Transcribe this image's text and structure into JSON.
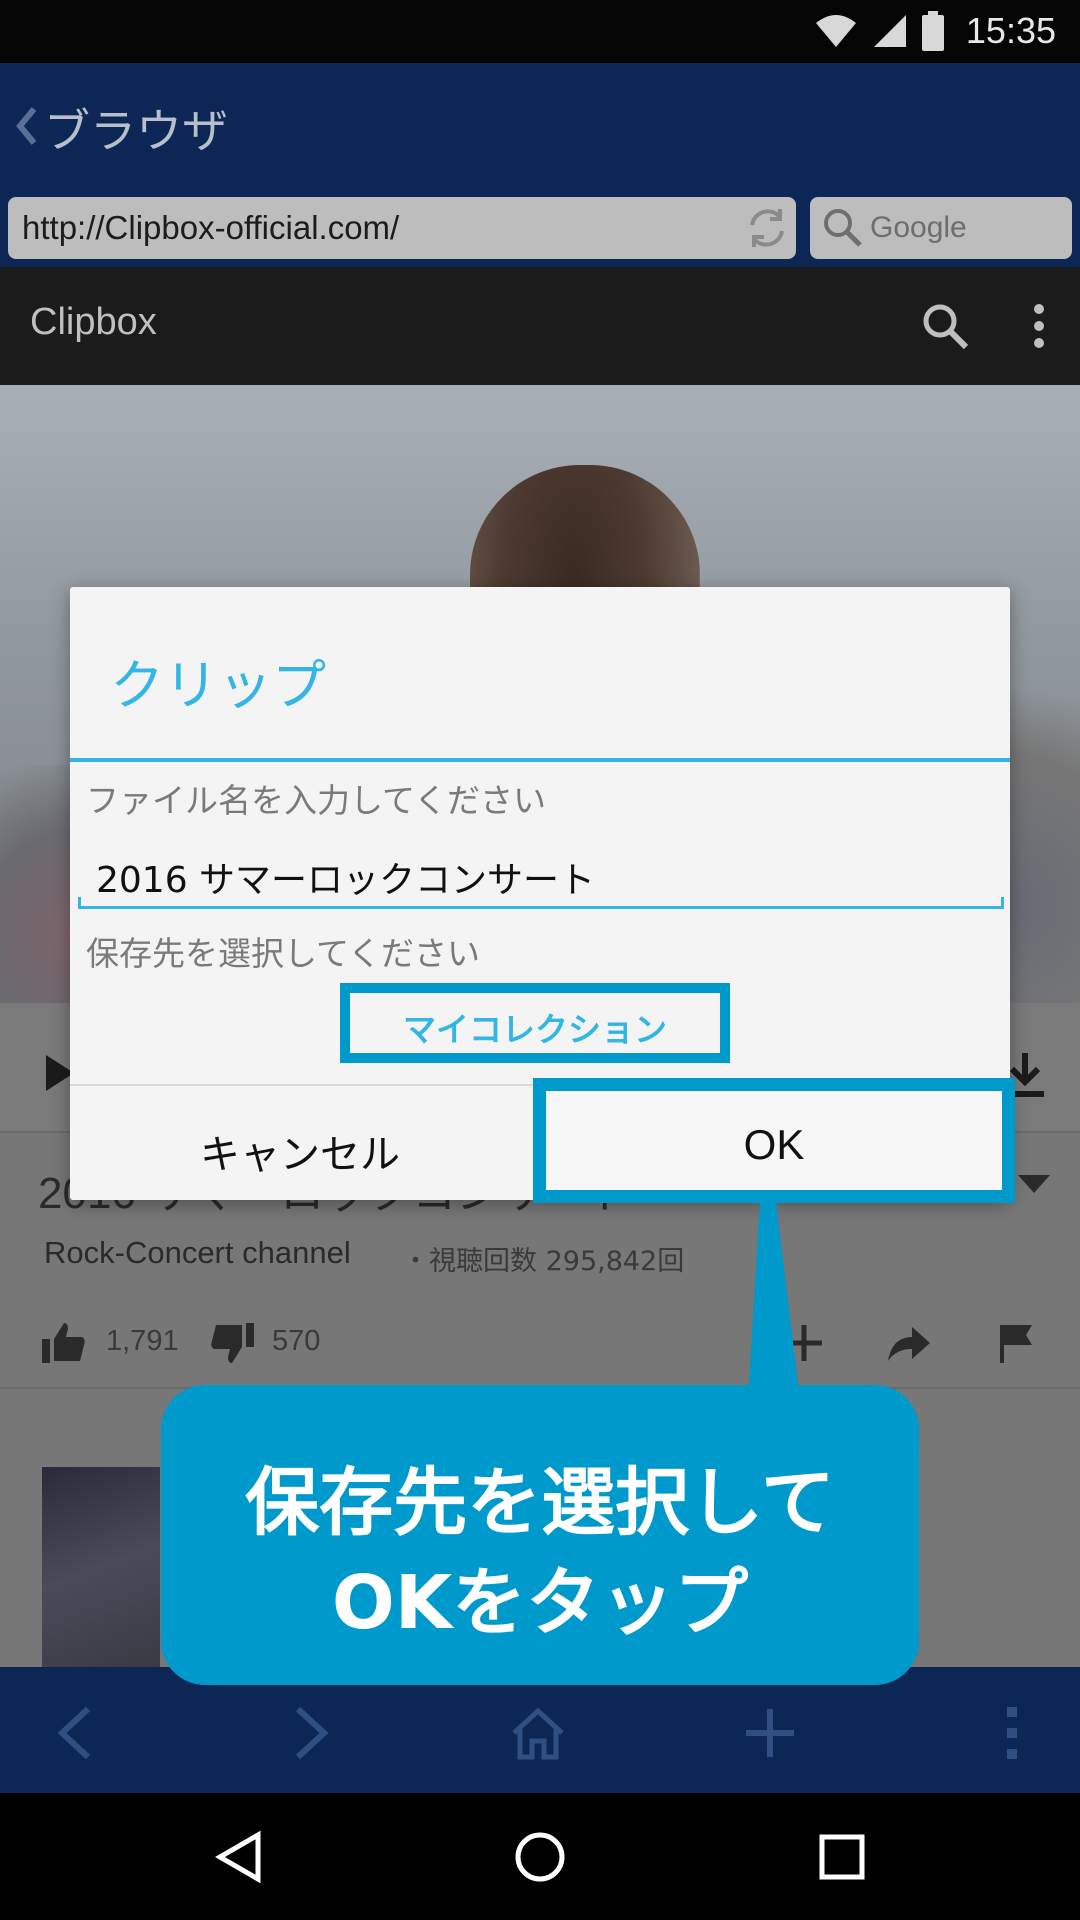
{
  "status_bar": {
    "time": "15:35"
  },
  "header": {
    "title": "ブラウザ"
  },
  "address_bar": {
    "url": "http://Clipbox-official.com/",
    "search_placeholder": "Google"
  },
  "site": {
    "name": "Clipbox"
  },
  "video": {
    "title": "2016 サマーロックコンサート",
    "channel": "Rock-Concert channel",
    "views": "・視聴回数 295,842回",
    "likes": "1,791",
    "dislikes": "570"
  },
  "dialog": {
    "title": "クリップ",
    "filename_prompt": "ファイル名を入力してください",
    "filename_value": "2016 サマーロックコンサート",
    "destination_prompt": "保存先を選択してください",
    "destination_button": "マイコレクション",
    "cancel_label": "キャンセル",
    "ok_label": "OK"
  },
  "callout": {
    "line1": "保存先を選択して",
    "line2": "OKをタップ"
  },
  "colors": {
    "accent": "#33b5e5",
    "callout": "#0099cc",
    "header": "#0c2755"
  }
}
